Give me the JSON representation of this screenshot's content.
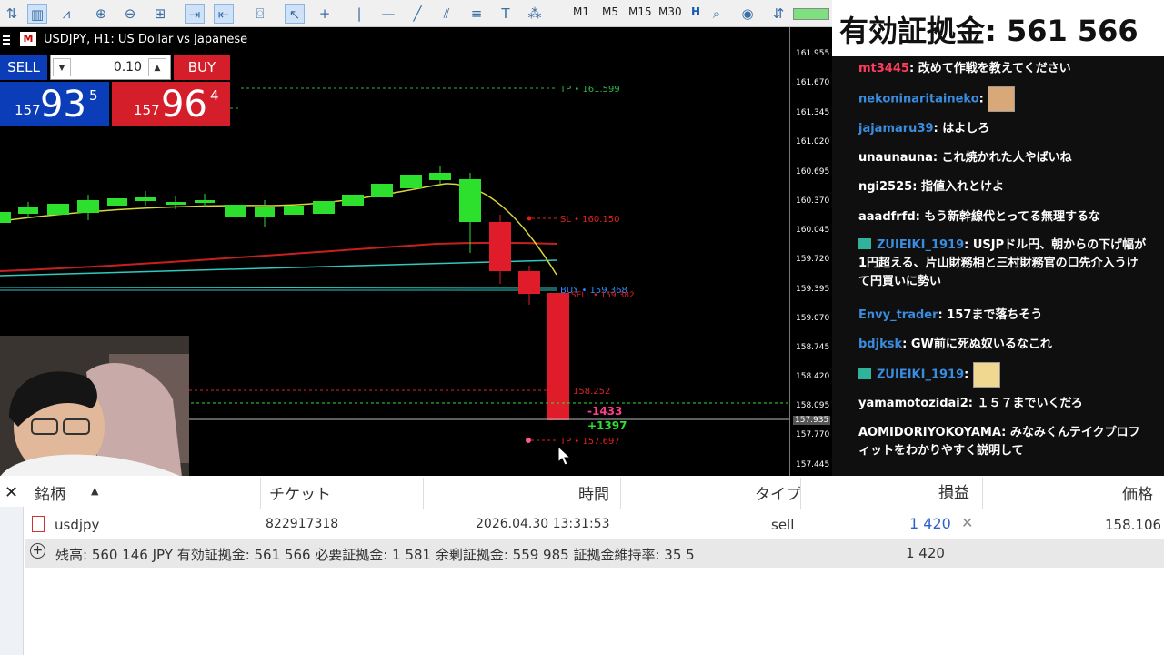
{
  "toolbar": {
    "timeframes": [
      "M1",
      "M5",
      "M15",
      "M30",
      "H"
    ],
    "active": "H"
  },
  "chart": {
    "title": "USDJPY, H1: US Dollar vs Japanese",
    "price_axis": [
      "161.955",
      "161.670",
      "161.345",
      "161.020",
      "160.695",
      "160.370",
      "160.045",
      "159.720",
      "159.395",
      "159.070",
      "158.745",
      "158.420",
      "158.095",
      "157.935",
      "157.770",
      "157.445"
    ],
    "current_price_label": "157.935",
    "lines": {
      "tp_top": "TP • 161.599",
      "sl": "SL • 160.150",
      "buy": "BUY • 159.368",
      "sell_tag": "SELL • 159.382",
      "mid": "158.252",
      "tp_bottom": "TP • 157.697"
    },
    "pl_tags": {
      "loss": "-1433",
      "gain": "+1397"
    }
  },
  "one_click": {
    "sell_label": "SELL",
    "buy_label": "BUY",
    "lot": "0.10",
    "lot_down": "▼",
    "lot_up": "▲",
    "sell": {
      "a": "157",
      "b": "93",
      "c": "5"
    },
    "buy": {
      "a": "157",
      "b": "96",
      "c": "4"
    }
  },
  "table": {
    "close": "✕",
    "sort_icon": "▲",
    "headers": [
      "銘柄",
      "チケット",
      "時間",
      "タイプ",
      "損益",
      "価格"
    ],
    "row": {
      "symbol": "usdjpy",
      "ticket": "822917318",
      "time": "2026.04.30 13:31:53",
      "type": "sell",
      "profit": "1 420",
      "close_x": "✕",
      "price": "158.106"
    },
    "summary_plus": "+",
    "summary": "残高: 560 146 JPY  有効証拠金: 561 566  必要証拠金: 1 581  余剰証拠金: 559 985  証拠金維持率: 35 5",
    "summary_profit": "1 420"
  },
  "overlay": {
    "equity": "有効証拠金: 561 566"
  },
  "chat": [
    {
      "user": "mt3445",
      "color": "#ff3b5c",
      "text": "改めて作戦を教えてください",
      "badge": false,
      "emoji": false
    },
    {
      "user": "nekoninaritaineko",
      "color": "#3a8dde",
      "text": "",
      "badge": false,
      "emoji": true
    },
    {
      "user": "jajamaru39",
      "color": "#3a8dde",
      "text": "はよしろ",
      "badge": false,
      "emoji": false
    },
    {
      "user": "unaunauna",
      "color": "#ffffff",
      "text": "これ焼かれた人やばいね",
      "badge": false,
      "emoji": false
    },
    {
      "user": "ngi2525",
      "color": "#ffffff",
      "text": "指値入れとけよ",
      "badge": false,
      "emoji": false
    },
    {
      "user": "aaadfrfd",
      "color": "#ffffff",
      "text": "もう新幹線代とってる無理するな",
      "badge": false,
      "emoji": false
    },
    {
      "user": "ZUIEIKI_1919",
      "color": "#3a8dde",
      "text": "USJPドル円、朝からの下げ幅が1円超える、片山財務相と三村財務官の口先介入うけて円買いに勢い",
      "badge": true,
      "emoji": false
    },
    {
      "user": "Envy_trader",
      "color": "#3a8dde",
      "text": "157まで落ちそう",
      "badge": false,
      "emoji": false
    },
    {
      "user": "bdjksk",
      "color": "#3a8dde",
      "text": "GW前に死ぬ奴いるなこれ",
      "badge": false,
      "emoji": false
    },
    {
      "user": "ZUIEIKI_1919",
      "color": "#3a8dde",
      "text": "",
      "badge": true,
      "emoji": true
    },
    {
      "user": "yamamotozidai2",
      "color": "#ffffff",
      "text": "１５７までいくだろ",
      "badge": false,
      "emoji": false
    },
    {
      "user": "AOMIDORIYOKOYAMA",
      "color": "#ffffff",
      "text": "みなみくんテイクプロフィットをわかりやすく説明して",
      "badge": false,
      "emoji": false
    }
  ]
}
